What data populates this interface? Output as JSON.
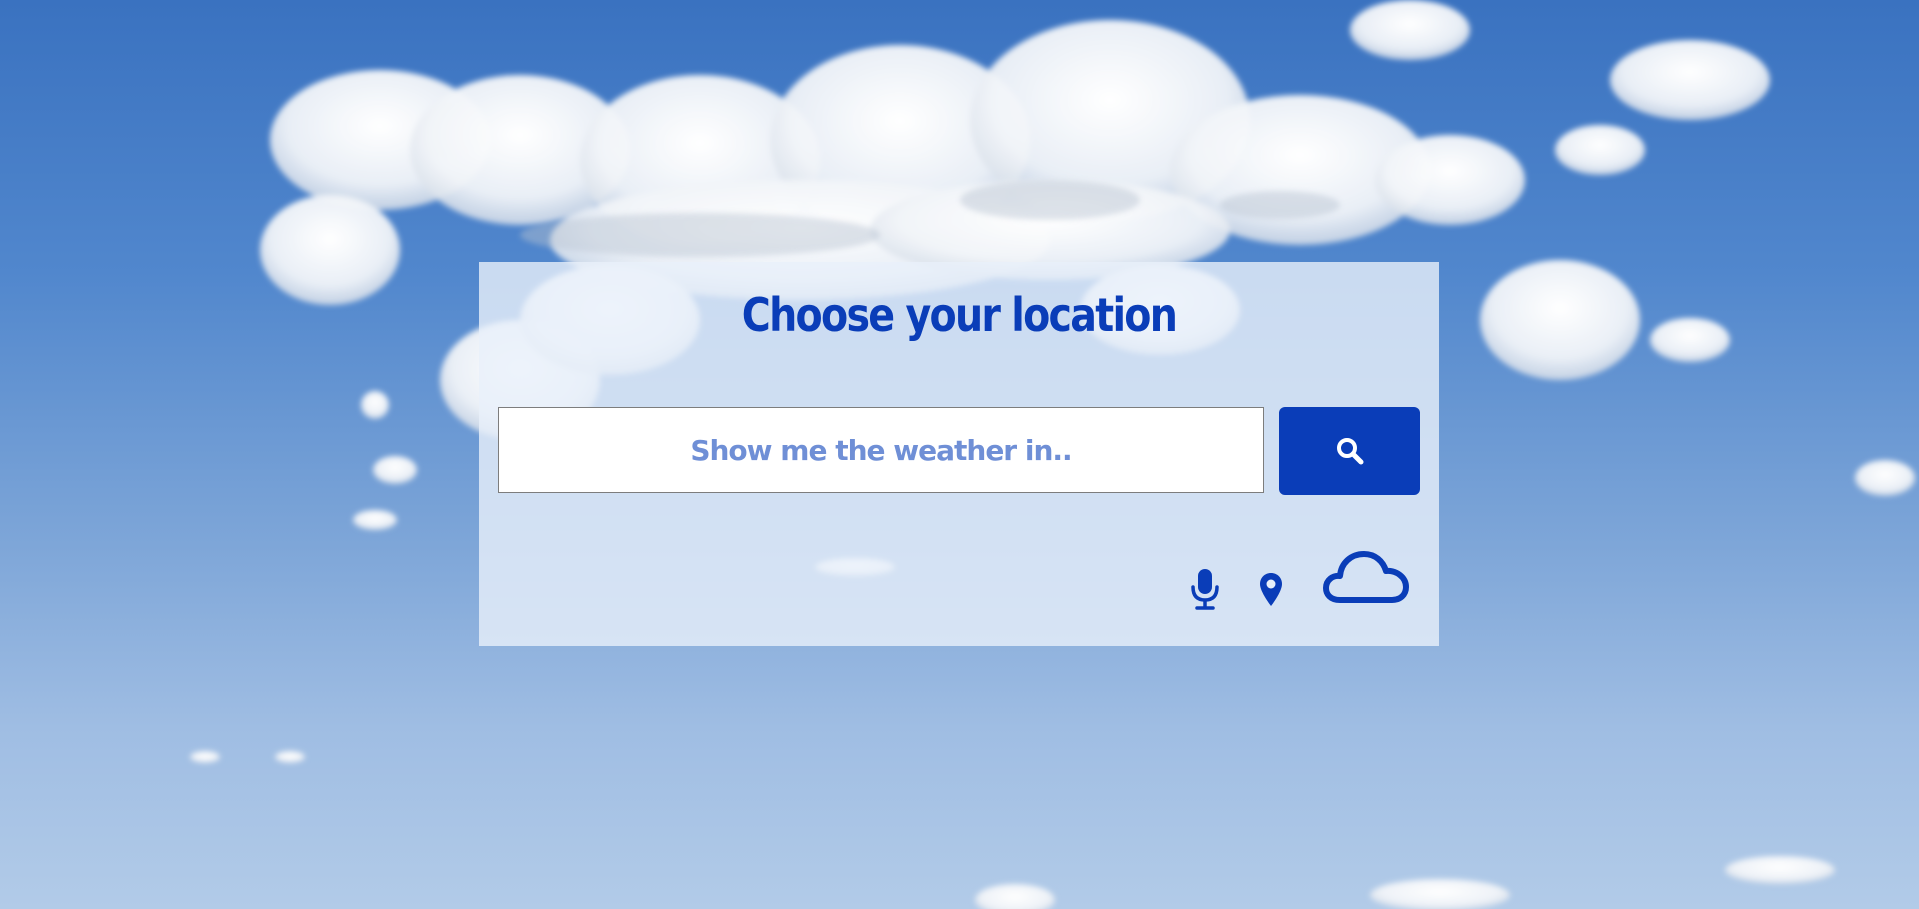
{
  "background": {
    "description_icon": "sky-with-clouds",
    "colors": {
      "sky_top": "#3a72c0",
      "sky_bottom": "#b2cbe8",
      "cloud": "#ffffff"
    }
  },
  "panel": {
    "title": "Choose your location"
  },
  "search": {
    "placeholder": "Show me the weather in..",
    "value": "",
    "button_icon": "search-icon"
  },
  "actions": [
    {
      "icon": "microphone-icon"
    },
    {
      "icon": "location-pin-icon"
    },
    {
      "icon": "cloud-icon"
    }
  ],
  "colors": {
    "accent": "#0a3db8",
    "placeholder": "#6f8fd6",
    "panel_bg": "#e8f0fa",
    "input_border": "#7d7d7d"
  }
}
